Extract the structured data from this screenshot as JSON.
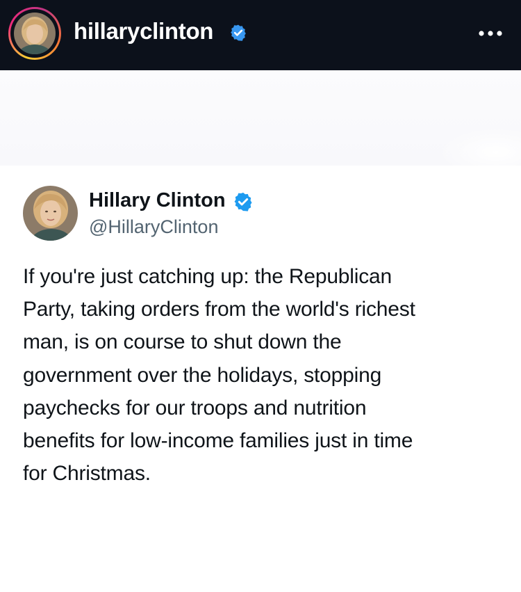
{
  "post_header": {
    "username": "hillaryclinton",
    "verified": true,
    "avatar_icon": "profile-photo-icon",
    "more_icon": "more-options-icon"
  },
  "tweet": {
    "display_name": "Hillary Clinton",
    "handle": "@HillaryClinton",
    "verified": true,
    "text": "If you're just catching up: the Republican\nParty, taking orders from the world's richest\nman, is on course to shut down the\ngovernment over the holidays, stopping\npaychecks for our troops and nutrition\nbenefits for low-income families just in time\nfor Christmas."
  },
  "colors": {
    "header_bg": "#0c111b",
    "verified_blue": "#1d9bf0",
    "text_primary": "#0f1419",
    "text_secondary": "#536471"
  }
}
